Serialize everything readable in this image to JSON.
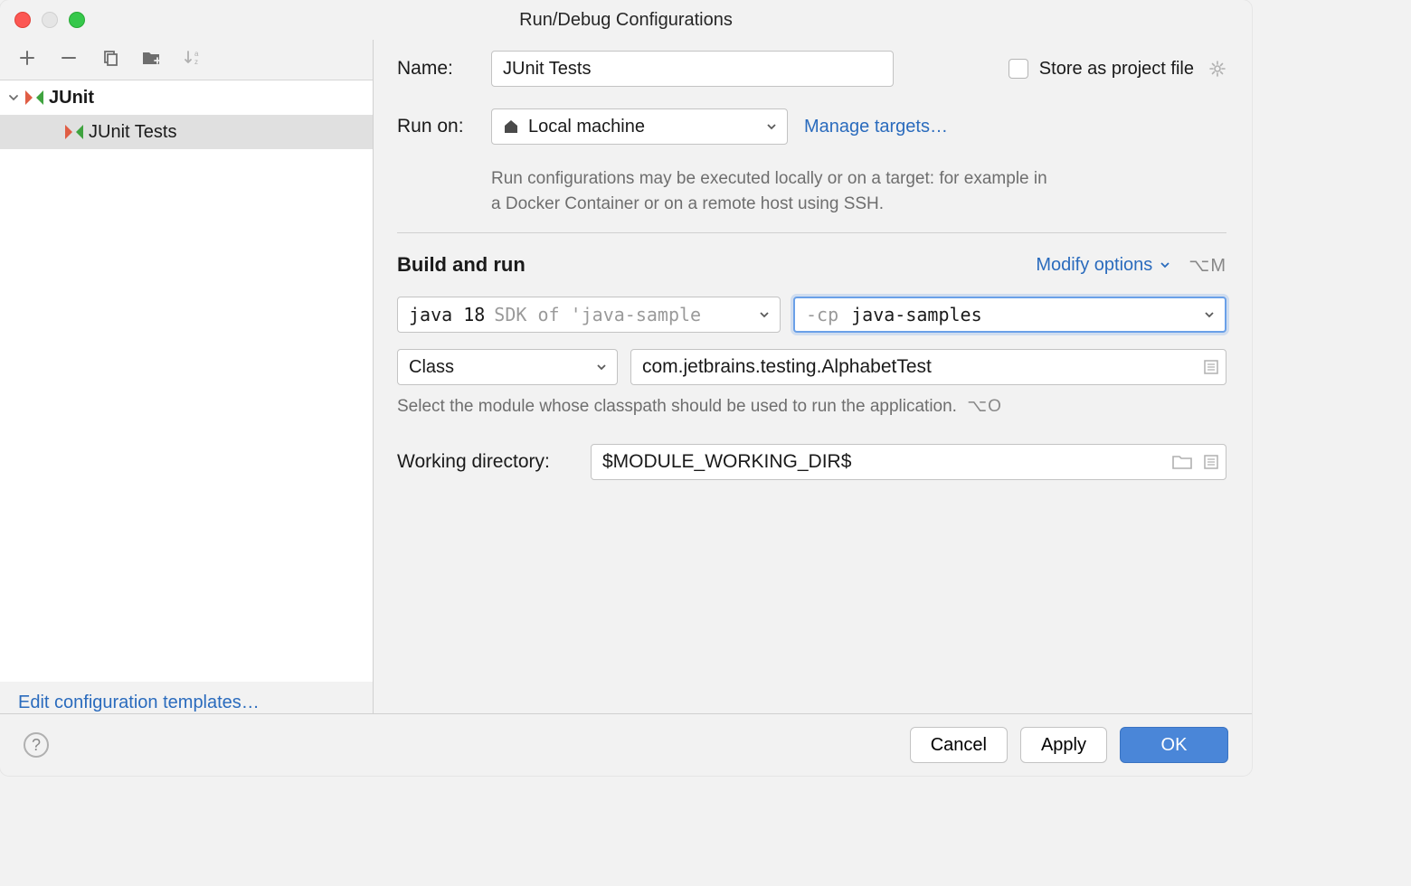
{
  "title": "Run/Debug Configurations",
  "sidebar": {
    "root_label": "JUnit",
    "child_label": "JUnit Tests",
    "edit_templates_link": "Edit configuration templates…"
  },
  "form": {
    "name_label": "Name:",
    "name_value": "JUnit Tests",
    "store_label": "Store as project file",
    "run_on_label": "Run on:",
    "run_on_value": "Local machine",
    "manage_targets_link": "Manage targets…",
    "run_on_hint": "Run configurations may be executed locally or on a target: for example in a Docker Container or on a remote host using SSH.",
    "section_title": "Build and run",
    "modify_options_label": "Modify options",
    "modify_options_shortcut": "⌥M",
    "jre_value": "java 18",
    "jre_suffix": "SDK of 'java-sample",
    "cp_prefix": "-cp",
    "cp_value": "java-samples",
    "test_kind_value": "Class",
    "class_value": "com.jetbrains.testing.AlphabetTest",
    "module_hint": "Select the module whose classpath should be used to run the application.",
    "module_hint_kbd": "⌥O",
    "wd_label": "Working directory:",
    "wd_value": "$MODULE_WORKING_DIR$"
  },
  "buttons": {
    "cancel": "Cancel",
    "apply": "Apply",
    "ok": "OK"
  }
}
